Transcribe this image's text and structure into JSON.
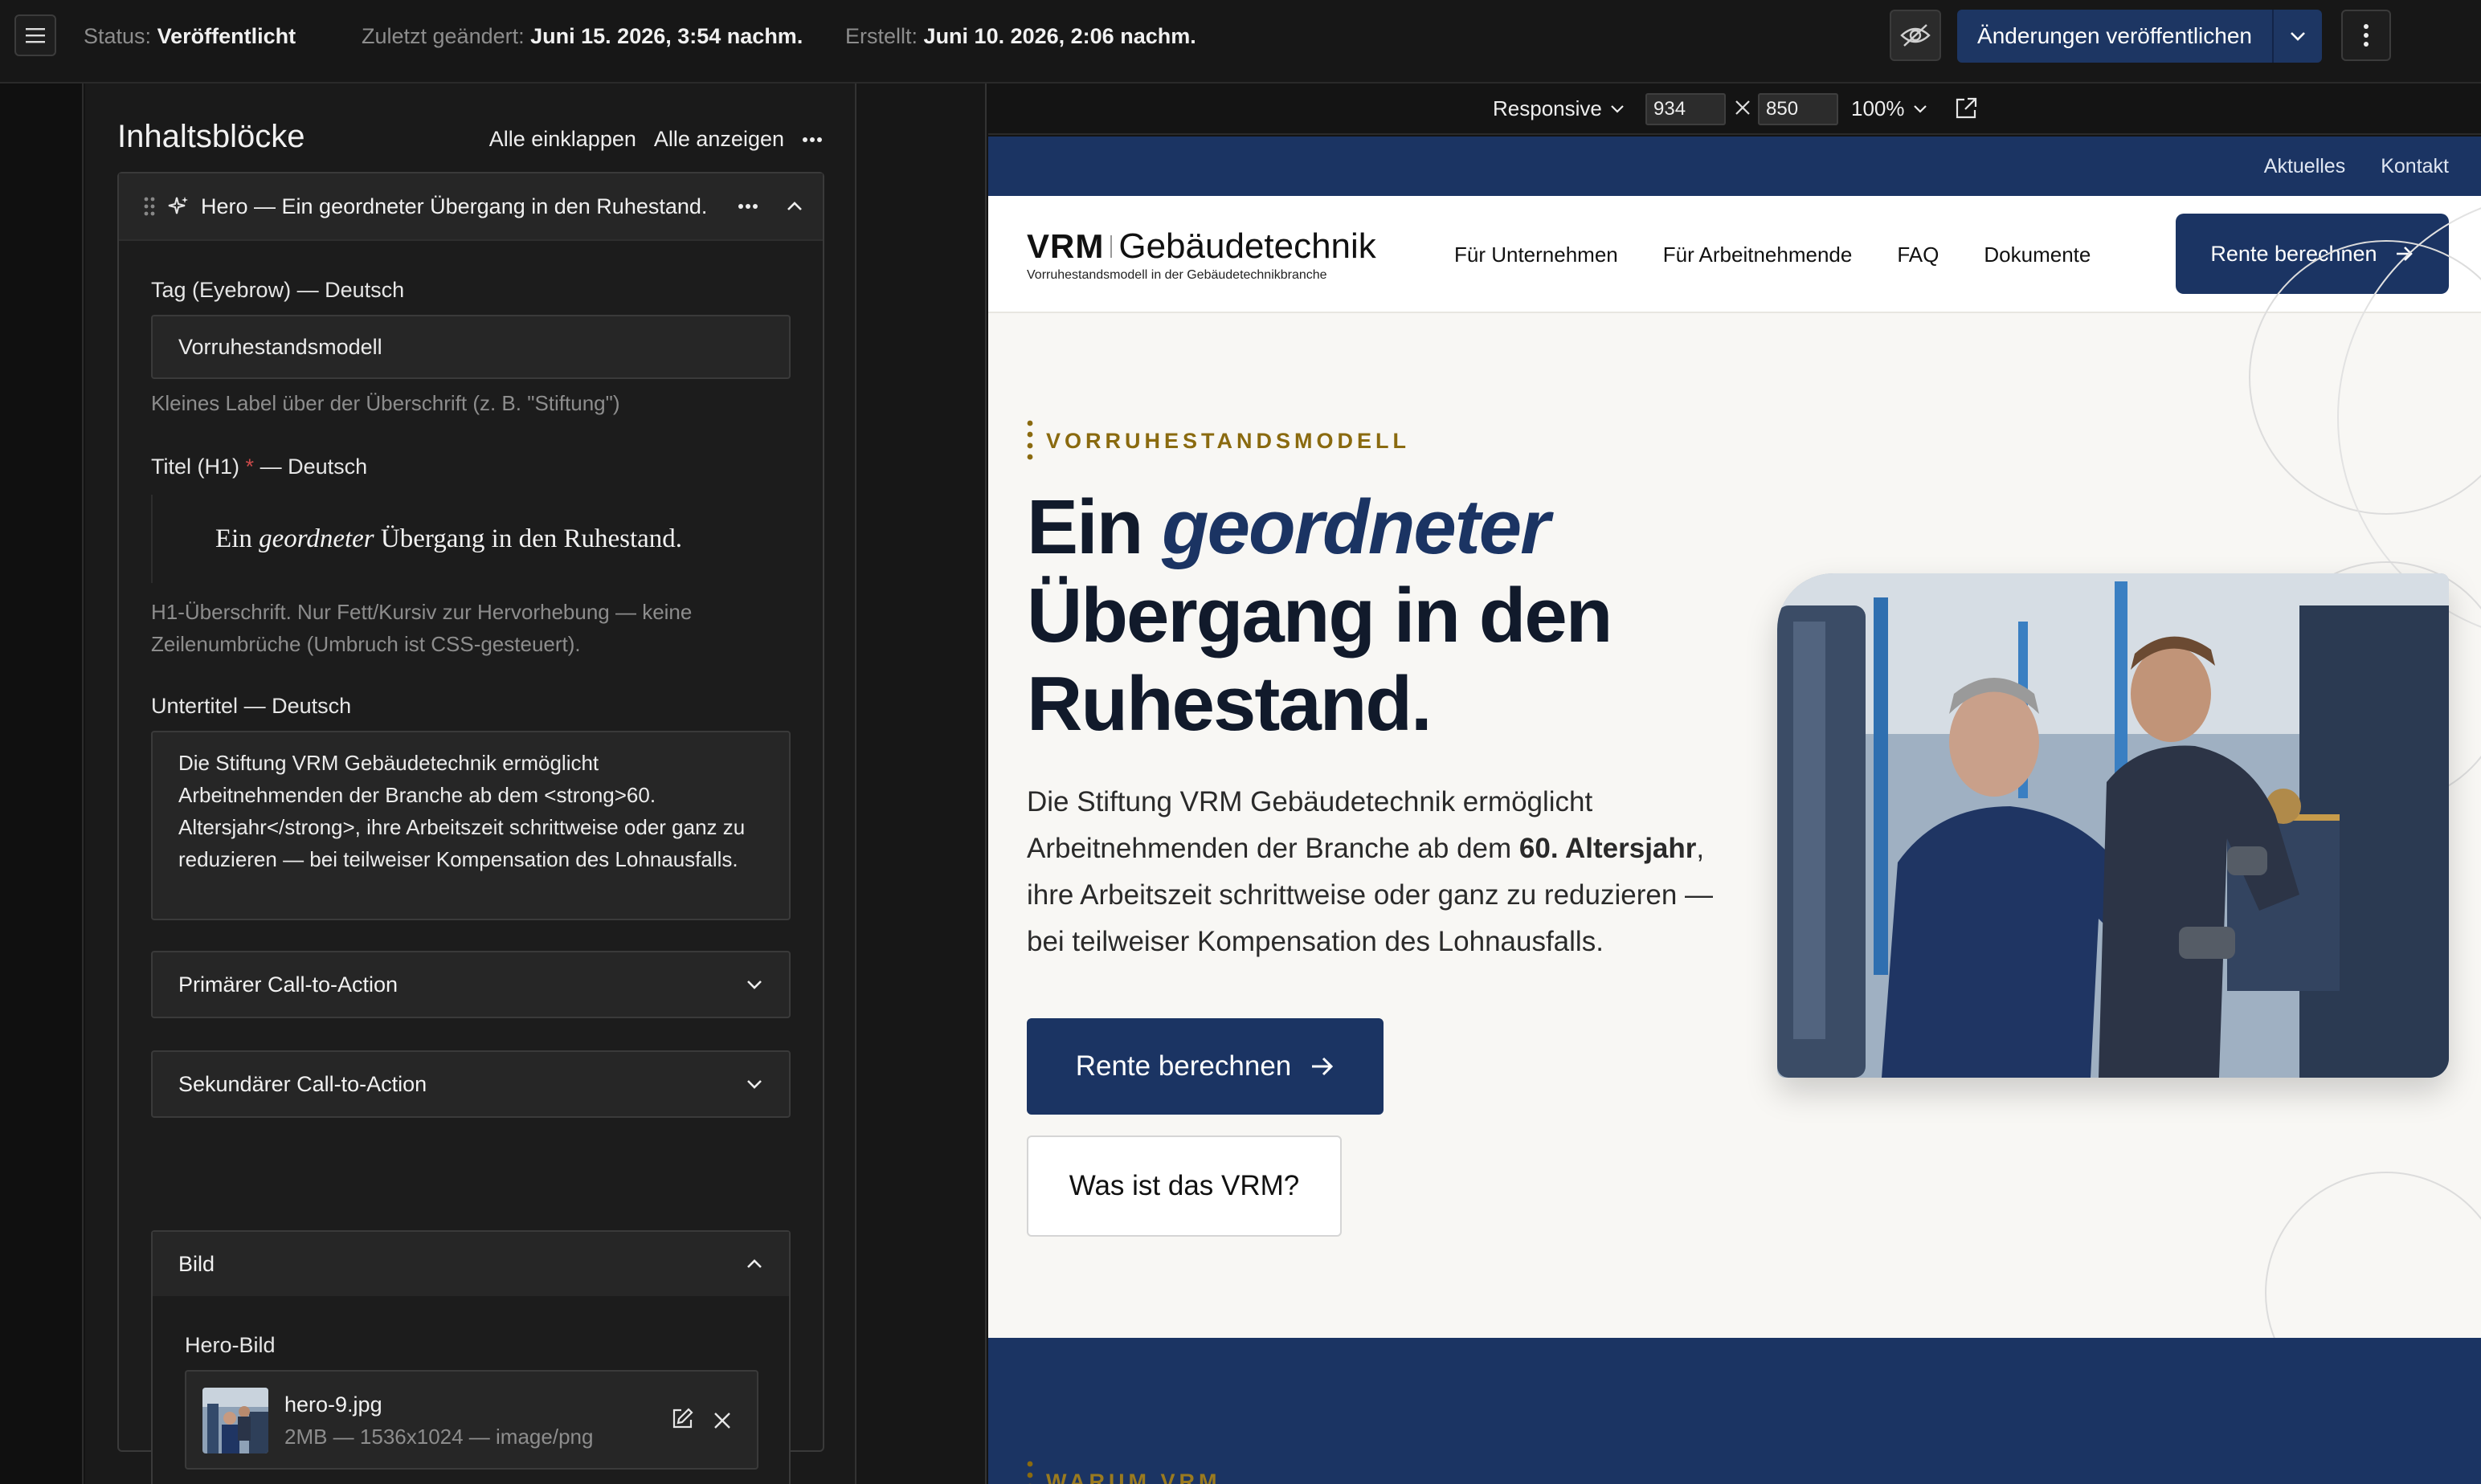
{
  "topbar": {
    "status_label": "Status:",
    "status_value": "Veröffentlicht",
    "modified_label": "Zuletzt geändert:",
    "modified_value": "Juni 15. 2026, 3:54 nachm.",
    "created_label": "Erstellt:",
    "created_value": "Juni 10. 2026, 2:06 nachm.",
    "publish_label": "Änderungen veröffentlichen"
  },
  "editor": {
    "title": "Inhaltsblöcke",
    "collapse_all": "Alle einklappen",
    "show_all": "Alle anzeigen",
    "block_title": "Hero — Ein geordneter Übergang in den Ruhestand.",
    "eyebrow_label": "Tag (Eyebrow)",
    "eyebrow_lang": "— Deutsch",
    "eyebrow_value": "Vorruhestandsmodell",
    "eyebrow_hint": "Kleines Label über der Überschrift (z. B. \"Stiftung\")",
    "title_label": "Titel (H1)",
    "title_required": "*",
    "title_lang": "— Deutsch",
    "title_pre": "Ein ",
    "title_italic": "geordneter",
    "title_post": " Übergang in den Ruhestand.",
    "title_hint": "H1-Überschrift. Nur Fett/Kursiv zur Hervorhebung — keine Zeilenumbrüche (Umbruch ist CSS-gesteuert).",
    "subtitle_label": "Untertitel",
    "subtitle_lang": "— Deutsch",
    "subtitle_value": "Die Stiftung VRM Gebäudetechnik ermöglicht Arbeitnehmenden der Branche ab dem <strong>60. Altersjahr</strong>, ihre Arbeitszeit schrittweise oder ganz zu reduzieren — bei teilweiser Kompensation des Lohnausfalls.",
    "primary_cta": "Primärer Call-to-Action",
    "secondary_cta": "Sekundärer Call-to-Action",
    "image_section": "Bild",
    "hero_image_label": "Hero-Bild",
    "file_name": "hero-9.jpg",
    "file_meta": "2MB — 1536x1024 — image/png"
  },
  "preview": {
    "mode": "Responsive",
    "width": "934",
    "height": "850",
    "zoom": "100%"
  },
  "site": {
    "util_links": [
      "Aktuelles",
      "Kontakt"
    ],
    "logo_name": "VRM",
    "logo_word": "Gebäudetechnik",
    "logo_tagline": "Vorruhestandsmodell in der Gebäudetechnikbranche",
    "nav": [
      "Für Unternehmen",
      "Für Arbeitnehmende",
      "FAQ",
      "Dokumente"
    ],
    "nav_cta": "Rente berechnen",
    "eyebrow": "VORRUHESTANDSMODELL",
    "h1_pre": "Ein ",
    "h1_italic": "geordneter",
    "h1_post": " Übergang in den Ruhestand.",
    "sub_pre": "Die Stiftung VRM Gebäudetechnik ermöglicht Arbeitnehmenden der Branche ab dem ",
    "sub_bold": "60. Altersjahr",
    "sub_post": ", ihre Arbeitszeit schrittweise oder ganz zu reduzieren — bei teilweiser Kompensation des Lohnausfalls.",
    "cta_primary": "Rente berechnen",
    "cta_secondary": "Was ist das VRM?",
    "next_eyebrow": "WARUM VRM"
  },
  "colors": {
    "brand_navy": "#1b3463",
    "accent_gold": "#8a6a0f",
    "editor_bg": "#1a1a1a"
  },
  "icons": [
    "menu-icon",
    "eye-off-icon",
    "chevron-down-icon",
    "kebab-icon",
    "drag-handle-icon",
    "sparkle-icon",
    "chevron-up-icon",
    "close-icon",
    "edit-icon",
    "external-link-icon",
    "arrow-right-icon"
  ]
}
